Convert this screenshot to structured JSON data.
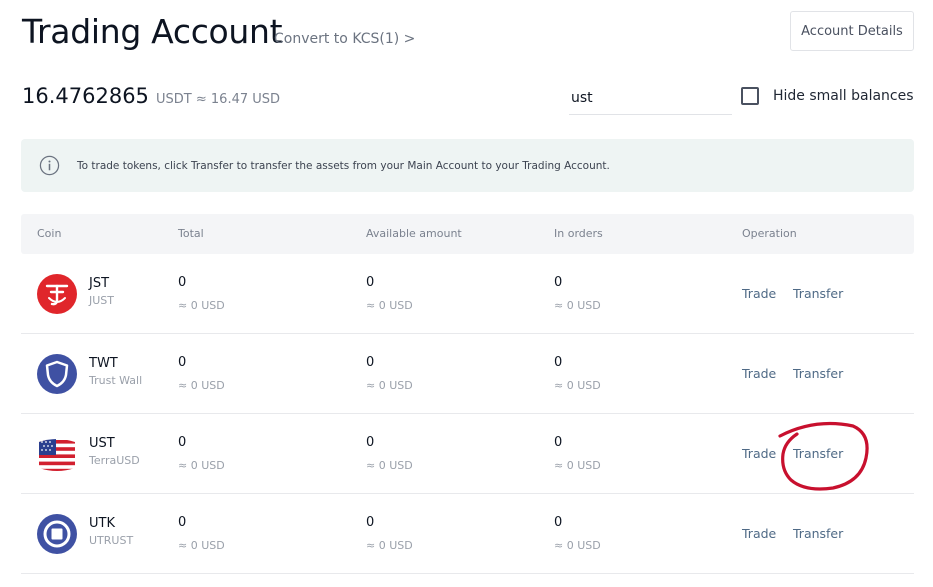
{
  "header": {
    "title": "Trading Account",
    "convert_link": "Convert to KCS(1) >",
    "account_details_label": "Account Details"
  },
  "balance": {
    "amount": "16.4762865",
    "unit_text": "USDT ≈ 16.47 USD"
  },
  "search": {
    "value": "ust",
    "placeholder": ""
  },
  "hide_small_balances": {
    "label": "Hide small balances",
    "checked": false
  },
  "notice": {
    "icon": "info-icon",
    "text": "To trade tokens, click Transfer to transfer the assets from your Main Account to your Trading Account."
  },
  "table": {
    "columns": [
      "Coin",
      "Total",
      "Available amount",
      "In orders",
      "Operation"
    ],
    "rows": [
      {
        "symbol": "JST",
        "name": "JUST",
        "icon": "jst-coin-icon",
        "total": "0",
        "total_usd": "≈ 0 USD",
        "available": "0",
        "available_usd": "≈ 0 USD",
        "in_orders": "0",
        "in_orders_usd": "≈ 0 USD",
        "trade": "Trade",
        "transfer": "Transfer"
      },
      {
        "symbol": "TWT",
        "name": "Trust Wall",
        "icon": "twt-shield-icon",
        "total": "0",
        "total_usd": "≈ 0 USD",
        "available": "0",
        "available_usd": "≈ 0 USD",
        "in_orders": "0",
        "in_orders_usd": "≈ 0 USD",
        "trade": "Trade",
        "transfer": "Transfer"
      },
      {
        "symbol": "UST",
        "name": "TerraUSD",
        "icon": "ust-flag-icon",
        "total": "0",
        "total_usd": "≈ 0 USD",
        "available": "0",
        "available_usd": "≈ 0 USD",
        "in_orders": "0",
        "in_orders_usd": "≈ 0 USD",
        "trade": "Trade",
        "transfer": "Transfer"
      },
      {
        "symbol": "UTK",
        "name": "UTRUST",
        "icon": "utk-coin-icon",
        "total": "0",
        "total_usd": "≈ 0 USD",
        "available": "0",
        "available_usd": "≈ 0 USD",
        "in_orders": "0",
        "in_orders_usd": "≈ 0 USD",
        "trade": "Trade",
        "transfer": "Transfer"
      }
    ]
  },
  "colors": {
    "accent_link": "#4f6a86",
    "annotation_circle": "#c8102e",
    "notice_bg": "#eef4f3",
    "jst_red": "#e0262b",
    "coin_blue": "#3f51a3"
  }
}
